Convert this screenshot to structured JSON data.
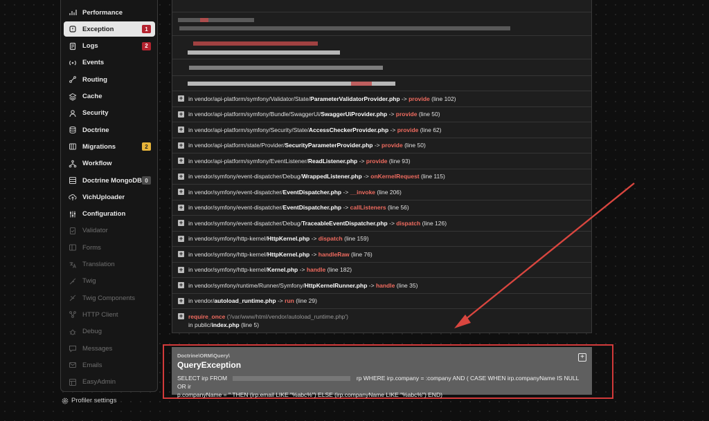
{
  "sidebar": {
    "items": [
      {
        "label": "Performance",
        "icon": "performance-icon",
        "state": "normal"
      },
      {
        "label": "Exception",
        "icon": "exception-icon",
        "state": "active",
        "badge": "1",
        "badge_color": "#b4232f"
      },
      {
        "label": "Logs",
        "icon": "logs-icon",
        "state": "normal",
        "badge": "2",
        "badge_color": "#b4232f"
      },
      {
        "label": "Events",
        "icon": "events-icon",
        "state": "normal"
      },
      {
        "label": "Routing",
        "icon": "routing-icon",
        "state": "normal"
      },
      {
        "label": "Cache",
        "icon": "cache-icon",
        "state": "normal"
      },
      {
        "label": "Security",
        "icon": "security-icon",
        "state": "normal"
      },
      {
        "label": "Doctrine",
        "icon": "doctrine-icon",
        "state": "normal"
      },
      {
        "label": "Migrations",
        "icon": "migrations-icon",
        "state": "normal",
        "badge": "2",
        "badge_color": "#e7b43a"
      },
      {
        "label": "Workflow",
        "icon": "workflow-icon",
        "state": "normal"
      },
      {
        "label": "Doctrine MongoDB",
        "icon": "mongodb-icon",
        "state": "normal",
        "badge": "0",
        "badge_color": "#4a4a4a"
      },
      {
        "label": "VichUploader",
        "icon": "upload-icon",
        "state": "normal"
      },
      {
        "label": "Configuration",
        "icon": "configuration-icon",
        "state": "normal"
      },
      {
        "label": "Validator",
        "icon": "validator-icon",
        "state": "disabled"
      },
      {
        "label": "Forms",
        "icon": "forms-icon",
        "state": "disabled"
      },
      {
        "label": "Translation",
        "icon": "translation-icon",
        "state": "disabled"
      },
      {
        "label": "Twig",
        "icon": "twig-icon",
        "state": "disabled"
      },
      {
        "label": "Twig Components",
        "icon": "twig-components-icon",
        "state": "disabled"
      },
      {
        "label": "HTTP Client",
        "icon": "http-client-icon",
        "state": "disabled"
      },
      {
        "label": "Debug",
        "icon": "debug-icon",
        "state": "disabled"
      },
      {
        "label": "Messages",
        "icon": "messages-icon",
        "state": "disabled"
      },
      {
        "label": "Emails",
        "icon": "emails-icon",
        "state": "disabled"
      },
      {
        "label": "EasyAdmin",
        "icon": "easyadmin-icon",
        "state": "disabled"
      }
    ],
    "profiler_settings": "Profiler settings"
  },
  "trace": {
    "frames": [
      {
        "prefix": "in vendor/api-platform/symfony/Validator/State/",
        "file": "ParameterValidatorProvider.php",
        "arrow": "->",
        "fn": "provide",
        "line": "(line 102)"
      },
      {
        "prefix": "in vendor/api-platform/symfony/Bundle/SwaggerUi/",
        "file": "SwaggerUiProvider.php",
        "arrow": "->",
        "fn": "provide",
        "line": "(line 50)"
      },
      {
        "prefix": "in vendor/api-platform/symfony/Security/State/",
        "file": "AccessCheckerProvider.php",
        "arrow": "->",
        "fn": "provide",
        "line": "(line 62)"
      },
      {
        "prefix": "in vendor/api-platform/state/Provider/",
        "file": "SecurityParameterProvider.php",
        "arrow": "->",
        "fn": "provide",
        "line": "(line 50)"
      },
      {
        "prefix": "in vendor/api-platform/symfony/EventListener/",
        "file": "ReadListener.php",
        "arrow": "->",
        "fn": "provide",
        "line": "(line 93)"
      },
      {
        "prefix": "in vendor/symfony/event-dispatcher/Debug/",
        "file": "WrappedListener.php",
        "arrow": "->",
        "fn": "onKernelRequest",
        "line": "(line 115)"
      },
      {
        "prefix": "in vendor/symfony/event-dispatcher/",
        "file": "EventDispatcher.php",
        "arrow": "->",
        "fn": "__invoke",
        "line": "(line 206)"
      },
      {
        "prefix": "in vendor/symfony/event-dispatcher/",
        "file": "EventDispatcher.php",
        "arrow": "->",
        "fn": "callListeners",
        "line": "(line 56)"
      },
      {
        "prefix": "in vendor/symfony/event-dispatcher/Debug/",
        "file": "TraceableEventDispatcher.php",
        "arrow": "->",
        "fn": "dispatch",
        "line": "(line 126)"
      },
      {
        "prefix": "in vendor/symfony/http-kernel/",
        "file": "HttpKernel.php",
        "arrow": "->",
        "fn": "dispatch",
        "line": "(line 159)"
      },
      {
        "prefix": "in vendor/symfony/http-kernel/",
        "file": "HttpKernel.php",
        "arrow": "->",
        "fn": "handleRaw",
        "line": "(line 76)"
      },
      {
        "prefix": "in vendor/symfony/http-kernel/",
        "file": "Kernel.php",
        "arrow": "->",
        "fn": "handle",
        "line": "(line 182)"
      },
      {
        "prefix": "in vendor/symfony/runtime/Runner/Symfony/",
        "file": "HttpKernelRunner.php",
        "arrow": "->",
        "fn": "handle",
        "line": "(line 35)"
      },
      {
        "prefix": "in vendor/",
        "file": "autoload_runtime.php",
        "arrow": "->",
        "fn": "run",
        "line": "(line 29)"
      }
    ],
    "last": {
      "fn": "require_once",
      "args": "('/var/www/html/vendor/autoload_runtime.php')",
      "location_prefix": "in public/",
      "location_file": "index.php",
      "location_line": "(line 5)"
    }
  },
  "exception": {
    "namespace": "Doctrine\\ORM\\Query\\",
    "class": "QueryException",
    "message_line1_a": "SELECT irp FROM",
    "message_line1_b": "rp WHERE irp.company = :company AND ( CASE WHEN irp.companyName IS NULL OR ir",
    "message_line2": "p.companyName = '' THEN (irp.email LIKE \"%abc%\") ELSE (irp.companyName LIKE \"%abc%\") END)"
  },
  "colors": {
    "accent_red": "#ef6b5f",
    "highlight_border": "#d33a3a",
    "arrow": "#d9463f"
  }
}
